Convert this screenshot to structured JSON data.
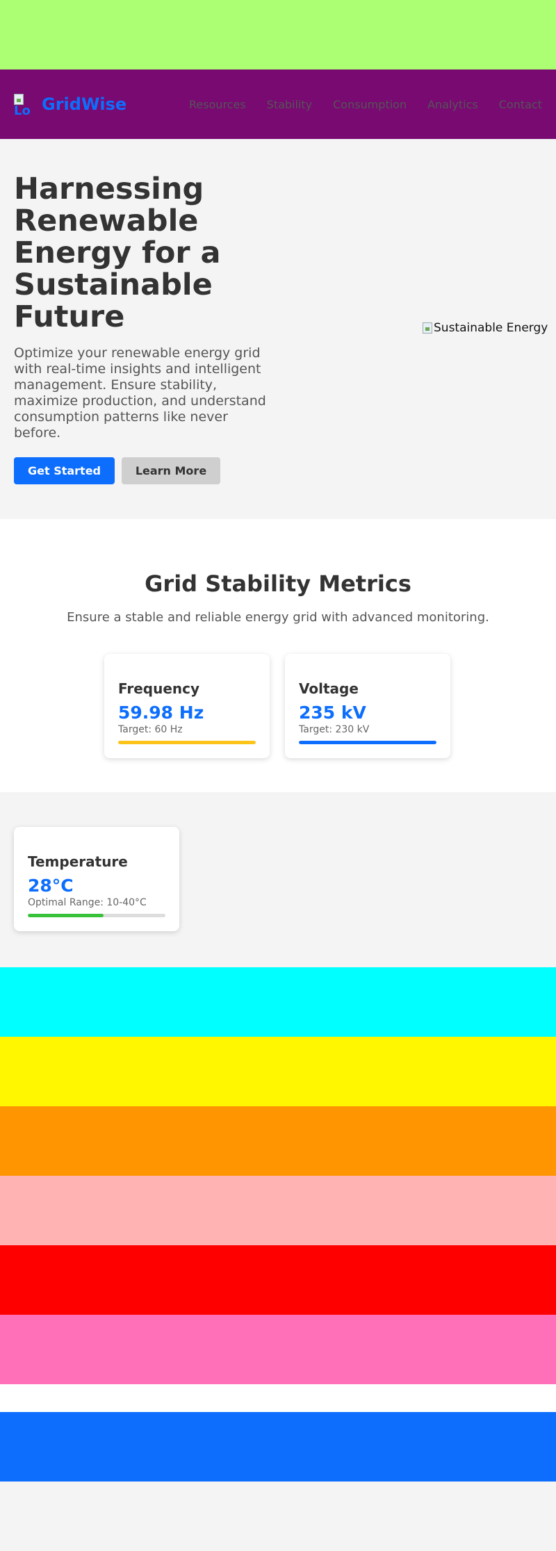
{
  "colors": {
    "accent": "#0d6efd",
    "nav_bg": "#780a72",
    "top_band": "#acff72",
    "bands": [
      "#00ffff",
      "#fff700",
      "#ff9500",
      "#ffb3b3",
      "#ff0000",
      "#ff70b8",
      "#ffffff",
      "#0d6efd",
      "#f4f4f4"
    ]
  },
  "nav": {
    "brand": "GridWise",
    "logo_icon": "broken-image-icon",
    "links": [
      "Resources",
      "Stability",
      "Consumption",
      "Analytics",
      "Contact"
    ]
  },
  "hero": {
    "title": "Harnessing Renewable Energy for a Sustainable Future",
    "description": "Optimize your renewable energy grid with real-time insights and intelligent management. Ensure stability, maximize production, and understand consumption patterns like never before.",
    "primary_button": "Get Started",
    "secondary_button": "Learn More",
    "image_alt": "Sustainable Energy"
  },
  "metrics": {
    "title": "Grid Stability Metrics",
    "subtitle": "Ensure a stable and reliable energy grid with advanced monitoring.",
    "cards": [
      {
        "label": "Frequency",
        "value": "59.98 Hz",
        "target": "Target: 60 Hz",
        "progress": 1.0,
        "color": "#fcc419"
      },
      {
        "label": "Voltage",
        "value": "235 kV",
        "target": "Target: 230 kV",
        "progress": 1.0,
        "color": "#0d6efd"
      }
    ]
  },
  "temperature": {
    "label": "Temperature",
    "value": "28°C",
    "target": "Optimal Range: 10-40°C",
    "progress": 0.55,
    "color": "#37c23a"
  }
}
